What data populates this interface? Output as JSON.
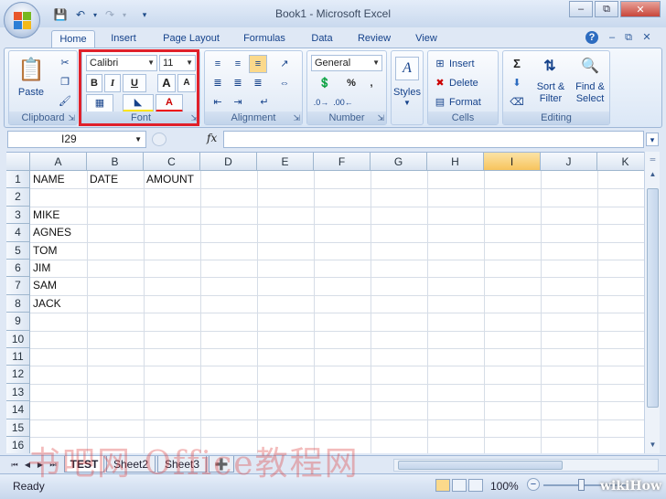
{
  "window": {
    "title": "Book1 - Microsoft Excel"
  },
  "tabs": [
    "Home",
    "Insert",
    "Page Layout",
    "Formulas",
    "Data",
    "Review",
    "View"
  ],
  "ribbon": {
    "clipboard": {
      "label": "Clipboard",
      "paste": "Paste"
    },
    "font": {
      "label": "Font",
      "name": "Calibri",
      "size": "11",
      "bold": "B",
      "italic": "I",
      "underline": "U",
      "grow": "A",
      "shrink": "A",
      "color_letter": "A"
    },
    "alignment": {
      "label": "Alignment"
    },
    "number": {
      "label": "Number",
      "format": "General",
      "percent": "%",
      "comma": ","
    },
    "styles": {
      "label": "Styles"
    },
    "cells": {
      "label": "Cells",
      "insert": "Insert",
      "delete": "Delete",
      "format": "Format"
    },
    "editing": {
      "label": "Editing",
      "sort": "Sort &",
      "sort2": "Filter",
      "find": "Find &",
      "find2": "Select",
      "sigma": "Σ"
    }
  },
  "formula_bar": {
    "name_box": "I29",
    "fx": "fx",
    "value": ""
  },
  "columns": [
    "A",
    "B",
    "C",
    "D",
    "E",
    "F",
    "G",
    "H",
    "I",
    "J",
    "K"
  ],
  "selected_column": "I",
  "rows": [
    "1",
    "2",
    "3",
    "4",
    "5",
    "6",
    "7",
    "8",
    "9",
    "10",
    "11",
    "12",
    "13",
    "14",
    "15",
    "16"
  ],
  "cells": {
    "A1": "NAME",
    "B1": "DATE",
    "C1": "AMOUNT",
    "A3": "MIKE",
    "A4": "AGNES",
    "A5": "TOM",
    "A6": "JIM",
    "A7": "SAM",
    "A8": "JACK"
  },
  "sheets": [
    "TEST",
    "Sheet2",
    "Sheet3"
  ],
  "active_sheet": "TEST",
  "status": {
    "text": "Ready",
    "zoom": "100%"
  },
  "watermark": "书吧网 Office教程网",
  "brand": "wikiHow",
  "colors": {
    "accent": "#15428b",
    "highlight": "#e0202a",
    "selected_header": "#f7c45d"
  }
}
